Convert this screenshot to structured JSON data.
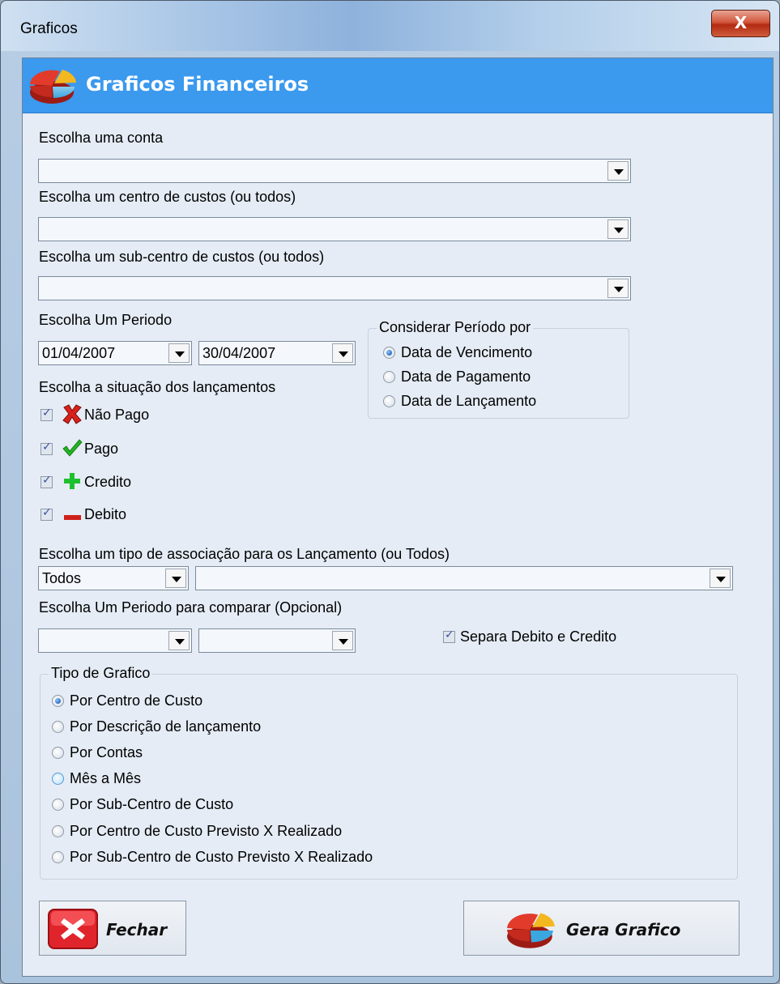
{
  "window": {
    "title": "Graficos",
    "close_label": "X"
  },
  "header": {
    "title": "Graficos Financeiros",
    "icon": "pie-chart-icon"
  },
  "conta": {
    "label": "Escolha uma conta",
    "value": ""
  },
  "centro": {
    "label": "Escolha um centro de custos (ou todos)",
    "value": ""
  },
  "subcentro": {
    "label": "Escolha um sub-centro de custos (ou todos)",
    "value": ""
  },
  "periodo": {
    "label": "Escolha Um Periodo",
    "start": "01/04/2007",
    "end": "30/04/2007"
  },
  "considerar": {
    "legend": "Considerar Período por",
    "options": [
      "Data de Vencimento",
      "Data de Pagamento",
      "Data de Lançamento"
    ],
    "selected": "Data de Vencimento"
  },
  "situacao": {
    "label": "Escolha a situação dos lançamentos",
    "items": [
      {
        "label": "Não Pago",
        "checked": true,
        "icon": "red-x-icon"
      },
      {
        "label": "Pago",
        "checked": true,
        "icon": "green-check-icon"
      },
      {
        "label": "Credito",
        "checked": true,
        "icon": "green-plus-icon"
      },
      {
        "label": "Debito",
        "checked": true,
        "icon": "red-minus-icon"
      }
    ]
  },
  "associacao": {
    "label": "Escolha um tipo de  associação para os Lançamento (ou Todos)",
    "type_value": "Todos",
    "value": ""
  },
  "comparar": {
    "label": "Escolha Um Periodo para comparar (Opcional)",
    "start": "",
    "end": ""
  },
  "separa": {
    "label": "Separa Debito e Credito",
    "checked": true
  },
  "tipo_grafico": {
    "legend": "Tipo de Grafico",
    "options": [
      "Por Centro de Custo",
      "Por Descrição de lançamento",
      "Por Contas",
      "Mês a Mês",
      "Por Sub-Centro de Custo",
      "Por Centro de Custo Previsto X Realizado",
      "Por Sub-Centro de Custo  Previsto X Realizado"
    ],
    "selected": "Por Centro de Custo",
    "hovered": "Mês a Mês"
  },
  "buttons": {
    "close_label": "Fechar",
    "generate_label": "Gera Grafico"
  },
  "colors": {
    "header_bg": "#3b99ee",
    "client_bg": "#e5ecf5"
  }
}
